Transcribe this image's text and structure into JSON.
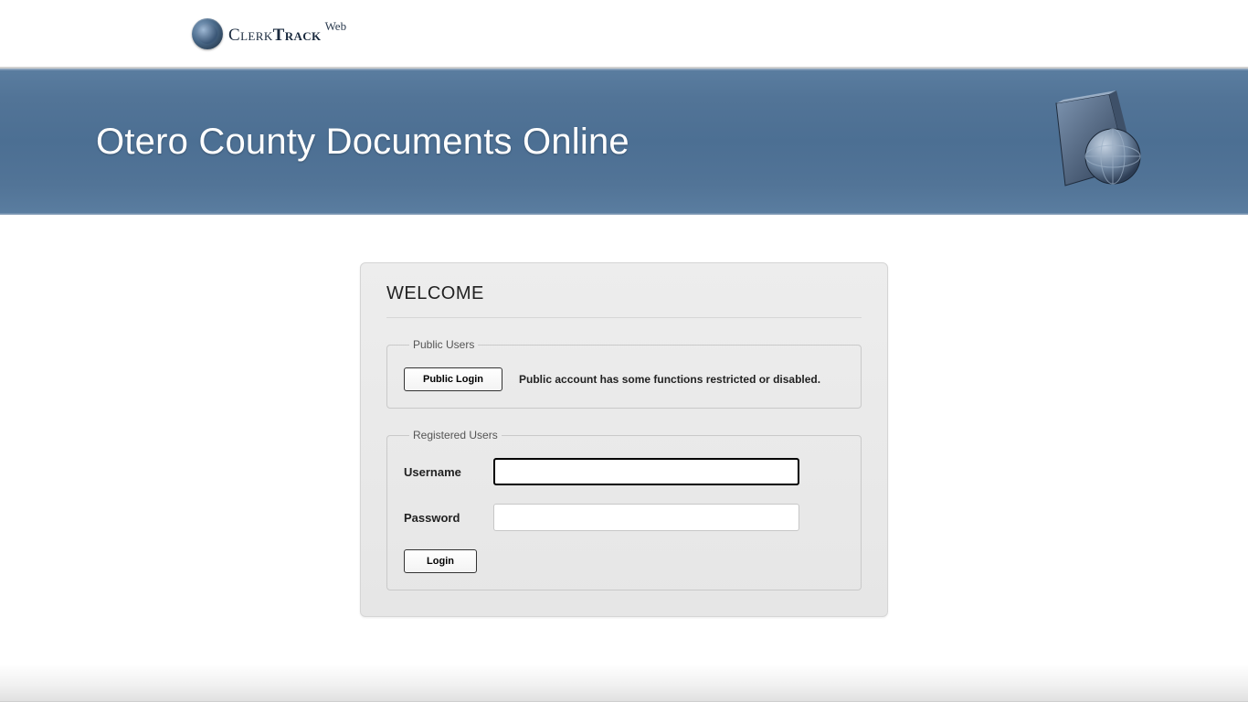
{
  "logo": {
    "text_thin": "Clerk",
    "text_bold": "Track",
    "super": "Web"
  },
  "banner": {
    "title": "Otero County Documents Online"
  },
  "panel": {
    "title": "WELCOME",
    "public": {
      "legend": "Public Users",
      "button": "Public Login",
      "note": "Public account has some functions restricted or disabled."
    },
    "registered": {
      "legend": "Registered Users",
      "username_label": "Username",
      "password_label": "Password",
      "username_value": "",
      "password_value": "",
      "login_button": "Login"
    }
  }
}
